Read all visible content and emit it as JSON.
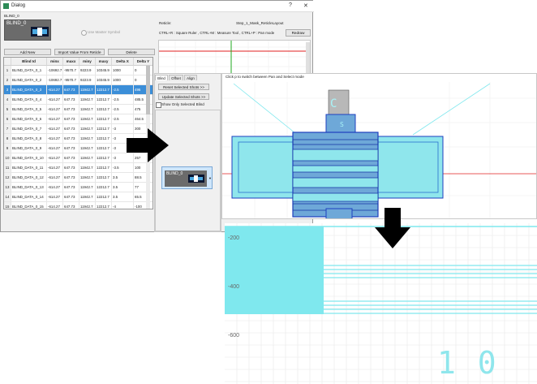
{
  "window": {
    "title": "Dialog",
    "help_glyph": "?",
    "close_glyph": "✕"
  },
  "blind": {
    "name_label": "BLIND_0",
    "thumb_text": "BLIND_0",
    "use_master_label": "Use Master Symbol",
    "add_new": "Add New",
    "import_label": "Import Value From Reticle",
    "delete_label": "Delete"
  },
  "reticle": {
    "label": "Reticle:",
    "value": "Step_1_Mask_ReticleLayout",
    "hint": "CTRL+R : Square Ruler , CTRL+M : Measure Tool , CTRL+P : Pan mode",
    "redraw_label": "Redraw"
  },
  "table": {
    "columns": [
      "Blind Id",
      "minx",
      "maxx",
      "miny",
      "maxy",
      "Delta X",
      "Delta Y"
    ],
    "rows": [
      {
        "n": "1",
        "id": "BLIND_DATA_0_1",
        "minx": "-10692.7",
        "maxx": "-9570.7",
        "miny": "9223.9",
        "maxy": "10345.9",
        "dx": "1000",
        "dy": "0"
      },
      {
        "n": "2",
        "id": "BLIND_DATA_0_2",
        "minx": "-10692.7",
        "maxx": "-9570.7",
        "miny": "9223.9",
        "maxy": "10345.9",
        "dx": "1000",
        "dy": "0"
      },
      {
        "n": "3",
        "id": "BLIND_DATA_0_3",
        "minx": "-614.27",
        "maxx": "647.73",
        "miny": "11942.7",
        "maxy": "12212.7",
        "dx": "-2.5",
        "dy": "496"
      },
      {
        "n": "4",
        "id": "BLIND_DATA_0_4",
        "minx": "-614.27",
        "maxx": "647.73",
        "miny": "11942.7",
        "maxy": "12212.7",
        "dx": "-2.5",
        "dy": "485.5"
      },
      {
        "n": "5",
        "id": "BLIND_DATA_0_5",
        "minx": "-614.27",
        "maxx": "647.73",
        "miny": "11942.7",
        "maxy": "12212.7",
        "dx": "-2.5",
        "dy": "475"
      },
      {
        "n": "6",
        "id": "BLIND_DATA_0_6",
        "minx": "-614.27",
        "maxx": "647.73",
        "miny": "11942.7",
        "maxy": "12212.7",
        "dx": "-2.5",
        "dy": "464.5"
      },
      {
        "n": "7",
        "id": "BLIND_DATA_0_7",
        "minx": "-614.27",
        "maxx": "647.73",
        "miny": "11942.7",
        "maxy": "12212.7",
        "dx": "-3",
        "dy": "300"
      },
      {
        "n": "8",
        "id": "BLIND_DATA_0_8",
        "minx": "-614.27",
        "maxx": "647.73",
        "miny": "11942.7",
        "maxy": "12212.7",
        "dx": "-3",
        "dy": ""
      },
      {
        "n": "9",
        "id": "BLIND_DATA_0_9",
        "minx": "-614.27",
        "maxx": "647.73",
        "miny": "11942.7",
        "maxy": "12212.7",
        "dx": "-3",
        "dy": ""
      },
      {
        "n": "10",
        "id": "BLIND_DATA_0_10",
        "minx": "-614.27",
        "maxx": "647.73",
        "miny": "11942.7",
        "maxy": "12212.7",
        "dx": "-3",
        "dy": "257"
      },
      {
        "n": "11",
        "id": "BLIND_DATA_0_11",
        "minx": "-614.27",
        "maxx": "647.73",
        "miny": "11942.7",
        "maxy": "12212.7",
        "dx": "-3.5",
        "dy": "100"
      },
      {
        "n": "12",
        "id": "BLIND_DATA_0_12",
        "minx": "-614.27",
        "maxx": "647.73",
        "miny": "11942.7",
        "maxy": "12212.7",
        "dx": "3.5",
        "dy": "88.5"
      },
      {
        "n": "13",
        "id": "BLIND_DATA_0_13",
        "minx": "-614.27",
        "maxx": "647.73",
        "miny": "11942.7",
        "maxy": "12212.7",
        "dx": "3.5",
        "dy": "77"
      },
      {
        "n": "14",
        "id": "BLIND_DATA_0_14",
        "minx": "-614.27",
        "maxx": "647.73",
        "miny": "11942.7",
        "maxy": "12212.7",
        "dx": "3.5",
        "dy": "65.5"
      },
      {
        "n": "15",
        "id": "BLIND_DATA_0_15",
        "minx": "-614.27",
        "maxx": "647.73",
        "miny": "11942.7",
        "maxy": "12212.7",
        "dx": "-4",
        "dy": "-100"
      }
    ],
    "selected_row": 2
  },
  "panel": {
    "tabs": [
      "Blind",
      "Offset",
      "Align"
    ],
    "reset_label": "Reset Selected Shots >>",
    "update_label": "Update Selected Shots >>",
    "show_only_label": "Show Only Selected Blind",
    "thumb_text": "BLIND_0"
  },
  "viewer": {
    "hint": "Click p to switch between Pan and Select mode",
    "glyph_c": "C",
    "glyph_small": "S",
    "axis_labels": [
      "-200",
      "-400",
      "-600"
    ],
    "big_text": "1 0"
  },
  "colors": {
    "selection": "#3b8ed8",
    "highlight_fill": "#7fe8ee",
    "outline_blue": "#1e3fbf",
    "crosshair_red": "#e02020",
    "crosshair_green": "#1fa81f",
    "arrow": "#000000"
  },
  "icons": [
    "app-icon",
    "right-arrow-icon",
    "down-arrow-icon",
    "dropdown-arrow-icon"
  ]
}
